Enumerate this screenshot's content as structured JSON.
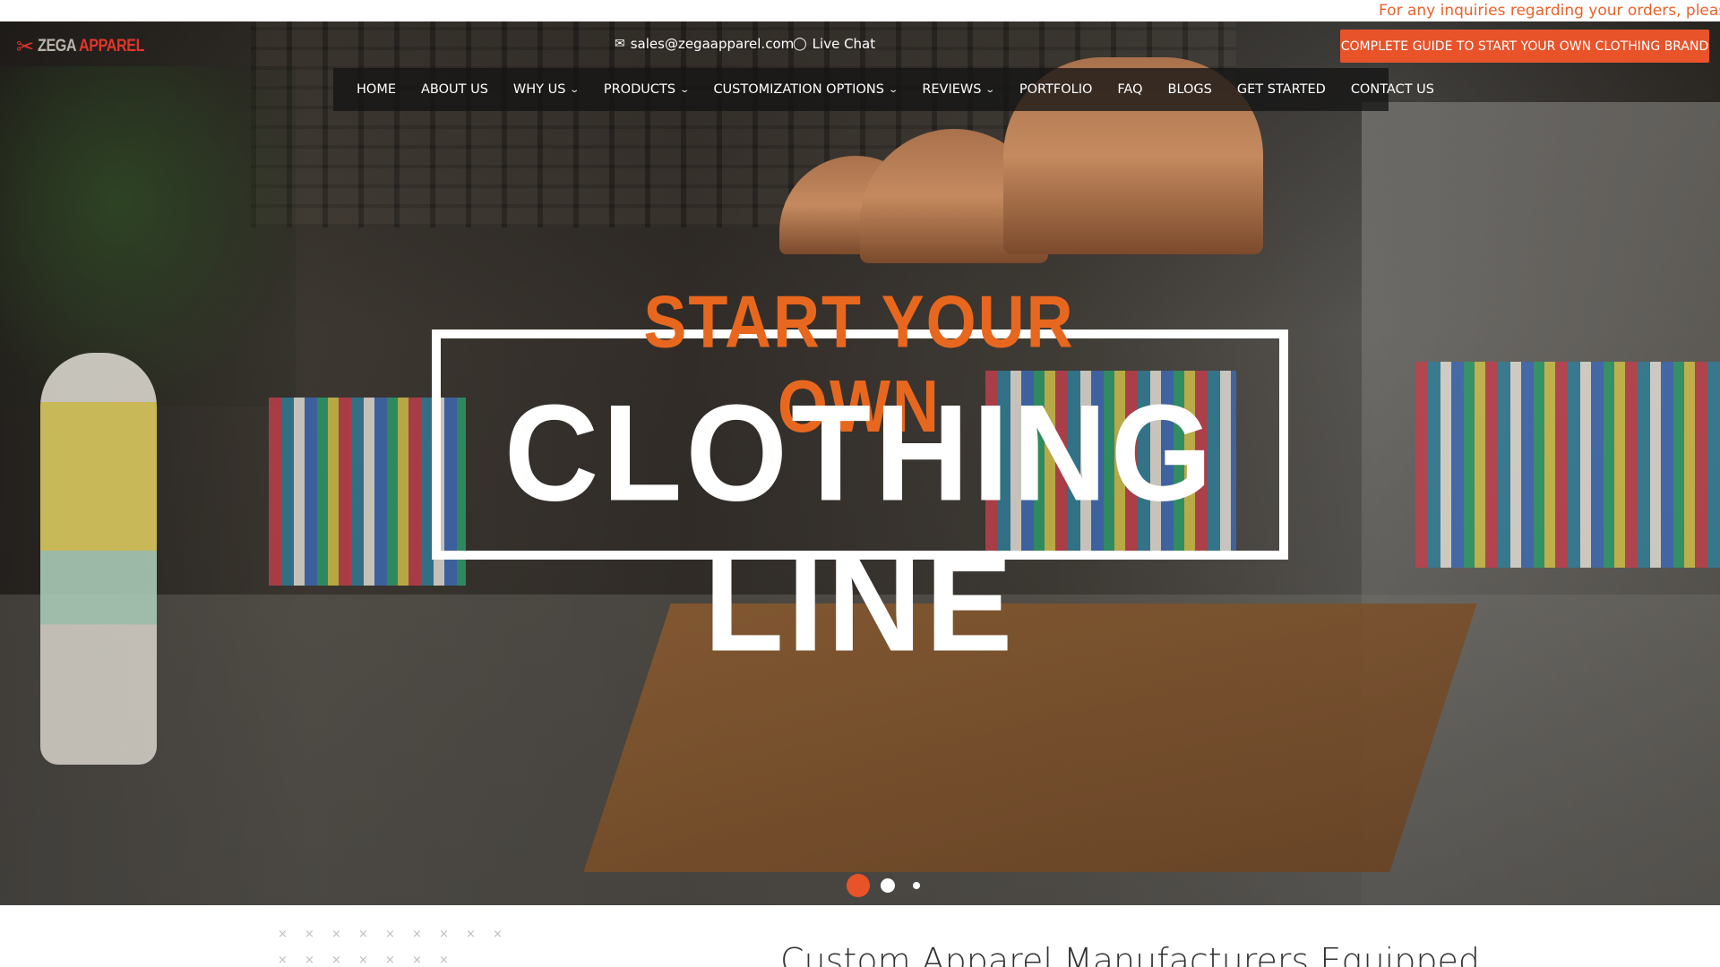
{
  "announcement": "For any inquiries regarding your orders, please do r",
  "brand": {
    "logo_mark": "✂",
    "logo_text_a": "ZEGA",
    "logo_text_b": "APPAREL",
    "accent_color": "#e8532a"
  },
  "header": {
    "email_icon": "mail-icon",
    "email": "sales@zegaapparel.com",
    "chat_icon": "chat-bubble-icon",
    "chat_label": "Live Chat",
    "cta_label": "COMPLETE GUIDE TO START YOUR OWN CLOTHING BRAND"
  },
  "nav": {
    "items": [
      {
        "label": "HOME"
      },
      {
        "label": "ABOUT US"
      },
      {
        "label": "WHY US",
        "chevron": "⌄"
      },
      {
        "label": "PRODUCTS",
        "chevron": "⌄"
      },
      {
        "label": "CUSTOMIZATION OPTIONS",
        "chevron": "⌄"
      },
      {
        "label": "REVIEWS",
        "chevron": "⌄"
      },
      {
        "label": "PORTFOLIO"
      },
      {
        "label": "FAQ"
      },
      {
        "label": "BLOGS"
      },
      {
        "label": "GET STARTED"
      },
      {
        "label": "CONTACT US"
      }
    ]
  },
  "hero": {
    "headline_top": "START YOUR OWN",
    "headline_main": "CLOTHING LINE",
    "slide_count": 3,
    "active_slide": 1
  },
  "section": {
    "title": "Custom Apparel Manufacturers Equipped",
    "pattern_glyph": "×"
  }
}
